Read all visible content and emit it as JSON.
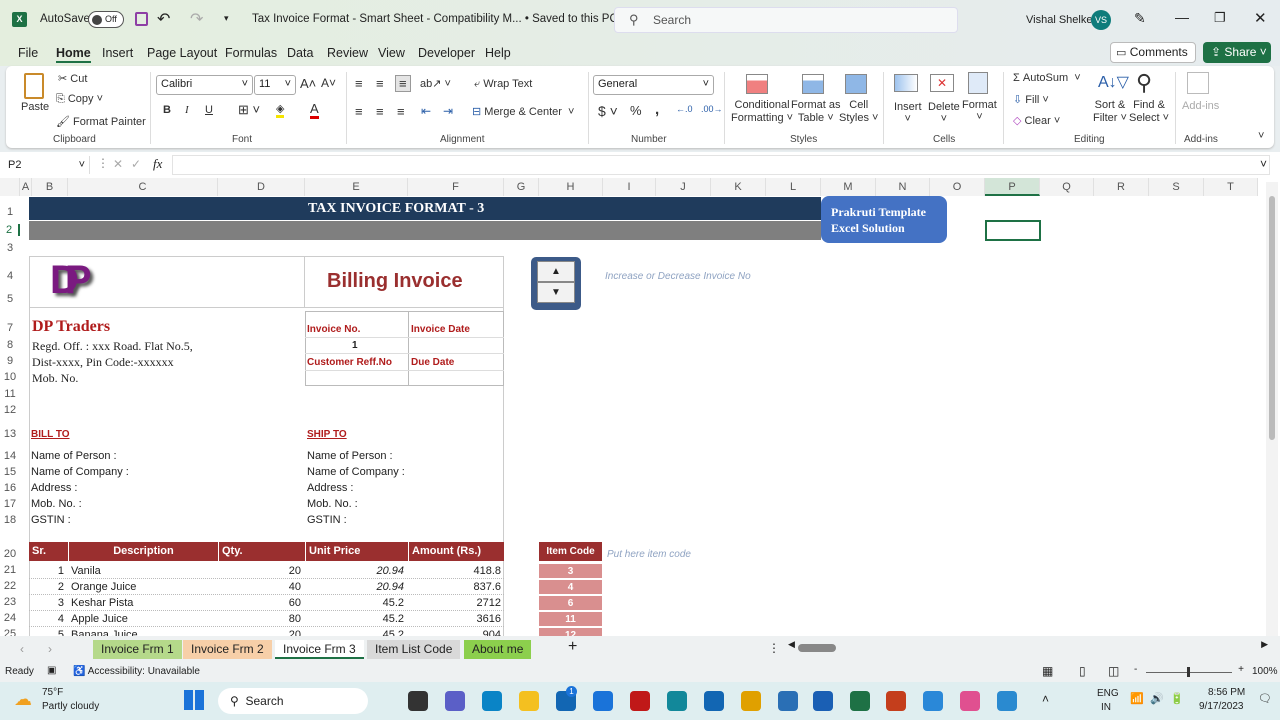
{
  "titlebar": {
    "autosave_label": "AutoSave",
    "autosave_state": "Off",
    "document_title": "Tax Invoice Format - Smart Sheet  -  Compatibility M...  •  Saved to this PC",
    "search_placeholder": "Search",
    "user_name": "Vishal Shelke",
    "user_initials": "VS"
  },
  "menu": [
    "File",
    "Home",
    "Insert",
    "Page Layout",
    "Formulas",
    "Data",
    "Review",
    "View",
    "Developer",
    "Help"
  ],
  "active_menu": "Home",
  "actions": {
    "comments": "Comments",
    "share": "Share"
  },
  "ribbon": {
    "clipboard": {
      "paste": "Paste",
      "cut": "Cut",
      "copy": "Copy",
      "format_painter": "Format Painter",
      "label": "Clipboard"
    },
    "font": {
      "name": "Calibri",
      "size": "11",
      "label": "Font",
      "bold": "B",
      "italic": "I",
      "underline": "U"
    },
    "alignment": {
      "wrap_text": "Wrap Text",
      "merge_center": "Merge & Center",
      "label": "Alignment"
    },
    "number": {
      "format": "General",
      "label": "Number"
    },
    "styles": {
      "conditional": "Conditional",
      "conditional2": "Formatting",
      "format_as": "Format as",
      "format_as2": "Table",
      "cell": "Cell",
      "cell2": "Styles",
      "label": "Styles"
    },
    "cells": {
      "insert": "Insert",
      "delete": "Delete",
      "format": "Format",
      "label": "Cells"
    },
    "editing": {
      "autosum": "AutoSum",
      "fill": "Fill",
      "clear": "Clear",
      "sort": "Sort &",
      "sort2": "Filter",
      "find": "Find &",
      "find2": "Select",
      "label": "Editing"
    },
    "addins": {
      "button": "Add-ins",
      "label": "Add-ins"
    }
  },
  "formula_bar": {
    "name_box": "P2",
    "fx": "fx",
    "value": ""
  },
  "columns": [
    "A",
    "B",
    "C",
    "D",
    "E",
    "F",
    "G",
    "H",
    "I",
    "J",
    "K",
    "L",
    "M",
    "N",
    "O",
    "P",
    "Q",
    "R",
    "S",
    "T"
  ],
  "rows": [
    "1",
    "2",
    "3",
    "4",
    "5",
    "7",
    "8",
    "9",
    "10",
    "11",
    "12",
    "13",
    "14",
    "15",
    "16",
    "17",
    "18",
    "20",
    "21",
    "22",
    "23",
    "24",
    "25"
  ],
  "sheet": {
    "title": "TAX INVOICE FORMAT - 3",
    "badge_line1": "Prakruti Template",
    "badge_line2": "Excel Solution",
    "logo": "DP",
    "billing_title": "Billing Invoice",
    "spinner_hint": "Increase or Decrease Invoice No",
    "company": "DP Traders",
    "address1": "Regd. Off. : xxx Road. Flat No.5,",
    "address2": "Dist-xxxx, Pin Code:-xxxxxx",
    "mobile": "Mob. No.",
    "invoice_no_label": "Invoice No.",
    "invoice_date_label": "Invoice Date",
    "invoice_no": "1",
    "cust_ref_label": "Customer Reff.No",
    "due_date_label": "Due Date",
    "bill_to": "BILL TO",
    "ship_to": "SHIP TO",
    "party_fields": [
      "Name of Person :",
      "Name of Company :",
      "Address :",
      "Mob. No. :",
      "GSTIN :"
    ],
    "table_headers": [
      "Sr. No.",
      "Description",
      "Qty.",
      "Unit Price",
      "Amount (Rs.)"
    ],
    "items": [
      {
        "sr": "1",
        "desc": "Vanila",
        "qty": "20",
        "price": "20.94",
        "amount": "418.8"
      },
      {
        "sr": "2",
        "desc": "Orange Juice",
        "qty": "40",
        "price": "20.94",
        "amount": "837.6"
      },
      {
        "sr": "3",
        "desc": "Keshar Pista",
        "qty": "60",
        "price": "45.2",
        "amount": "2712"
      },
      {
        "sr": "4",
        "desc": "Apple Juice",
        "qty": "80",
        "price": "45.2",
        "amount": "3616"
      },
      {
        "sr": "5",
        "desc": "Banana Juice",
        "qty": "20",
        "price": "45.2",
        "amount": "904"
      }
    ],
    "item_code_header": "Item Code",
    "item_code_hint": "Put here item code",
    "item_codes": [
      "3",
      "4",
      "6",
      "11",
      "12"
    ]
  },
  "tabs": [
    {
      "label": "Invoice Frm 1",
      "color": "#b5d98a"
    },
    {
      "label": "Invoice Frm 2",
      "color": "#f7cfa8"
    },
    {
      "label": "Invoice Frm 3",
      "color": "#ffffff"
    },
    {
      "label": "Item List Code",
      "color": "#d9d9d9"
    },
    {
      "label": "About me",
      "color": "#8ccf4d"
    }
  ],
  "active_tab": "Invoice Frm 3",
  "status": {
    "ready": "Ready",
    "accessibility": "Accessibility: Unavailable",
    "zoom": "100%"
  },
  "taskbar": {
    "temp": "75°F",
    "weather": "Partly cloudy",
    "search": "Search",
    "lang1": "ENG",
    "lang2": "IN",
    "time": "8:56 PM",
    "date": "9/17/2023",
    "badge": "1"
  },
  "colors": {
    "excel_green": "#1e7145",
    "header_navy": "#1f3b5c",
    "header_gray": "#7f7f7f",
    "table_header": "#9a2f2f",
    "accent_red": "#b01c1c",
    "badge_blue": "#4472c4"
  }
}
